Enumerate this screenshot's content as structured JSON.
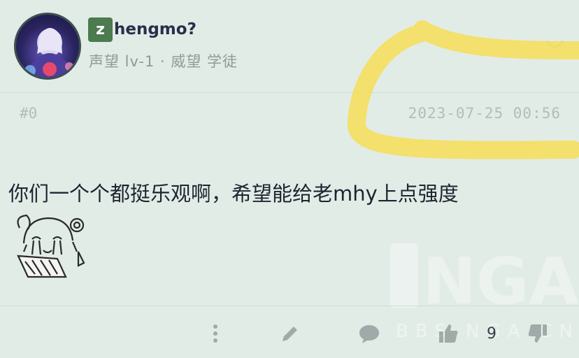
{
  "post": {
    "author": {
      "initial": "z",
      "name_rest": "hengmo?",
      "meta": "声望 lv-1 · 威望 学徒"
    },
    "floor": "#0",
    "timestamp": "2023-07-25 00:56",
    "content": "你们一个个都挺乐观啊，希望能给老mhy上点强度",
    "watermark_text": "NGA",
    "watermark_url": "BBS.NGA.CN",
    "actions": {
      "like_count": "9"
    }
  },
  "colors": {
    "background": "#e2ece6",
    "badge": "#4b7b4e",
    "highlight": "#f6de57",
    "icon": "#4d5a60"
  },
  "icons": [
    "dropdown-chevron-icon",
    "more-vertical-icon",
    "edit-pencil-icon",
    "comment-icon",
    "thumbs-up-icon",
    "thumbs-down-icon"
  ]
}
